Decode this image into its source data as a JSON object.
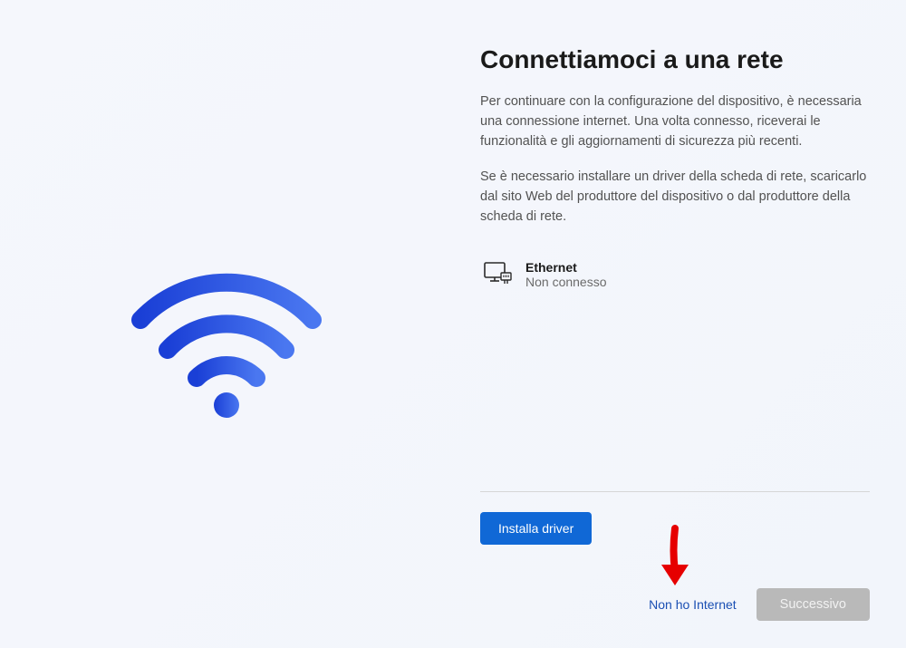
{
  "page": {
    "title": "Connettiamoci a una rete",
    "paragraph1": "Per continuare con la configurazione del dispositivo, è necessaria una connessione internet. Una volta connesso, riceverai le funzionalità e gli aggiornamenti di sicurezza più recenti.",
    "paragraph2": "Se è necessario installare un driver della scheda di rete, scaricarlo dal sito Web del produttore del dispositivo o dal produttore della scheda di rete."
  },
  "network": {
    "name": "Ethernet",
    "status": "Non connesso"
  },
  "buttons": {
    "installDriver": "Installa driver",
    "noInternet": "Non ho Internet",
    "next": "Successivo"
  }
}
